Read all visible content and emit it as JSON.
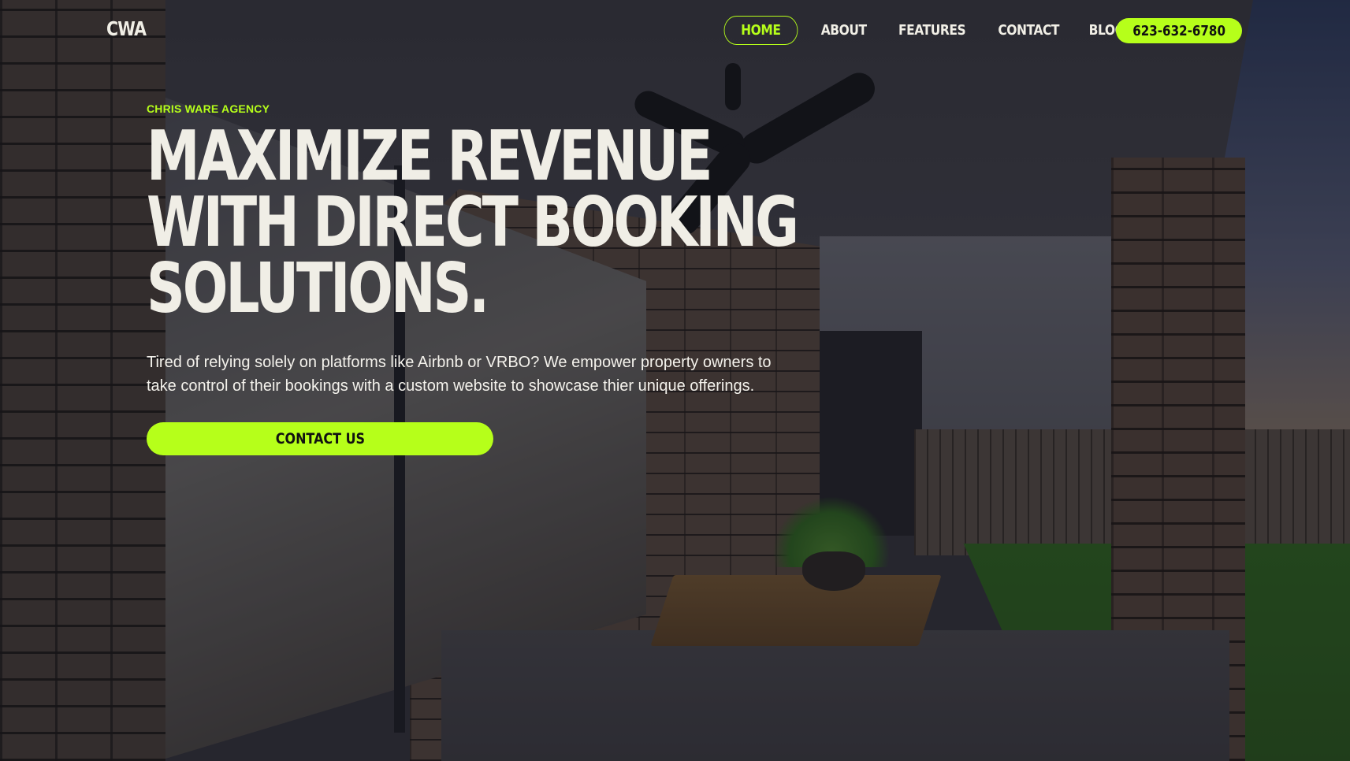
{
  "brand": {
    "logo": "CWA"
  },
  "nav": {
    "items": [
      {
        "label": "HOME",
        "active": true
      },
      {
        "label": "ABOUT",
        "active": false
      },
      {
        "label": "FEATURES",
        "active": false
      },
      {
        "label": "CONTACT",
        "active": false
      },
      {
        "label": "BLOG",
        "active": false
      }
    ],
    "phone": "623-632-6780"
  },
  "hero": {
    "eyebrow": "CHRIS WARE AGENCY",
    "headline": "MAXIMIZE REVENUE WITH DIRECT BOOKING SOLUTIONS.",
    "subtext": "Tired of relying solely on platforms like Airbnb or VRBO? We empower property owners to take control of their bookings with a custom website to showcase thier unique offerings.",
    "cta_label": "CONTACT US"
  },
  "colors": {
    "accent": "#b6ff1a",
    "text_light": "#f0eee6",
    "overlay": "#14141c"
  }
}
